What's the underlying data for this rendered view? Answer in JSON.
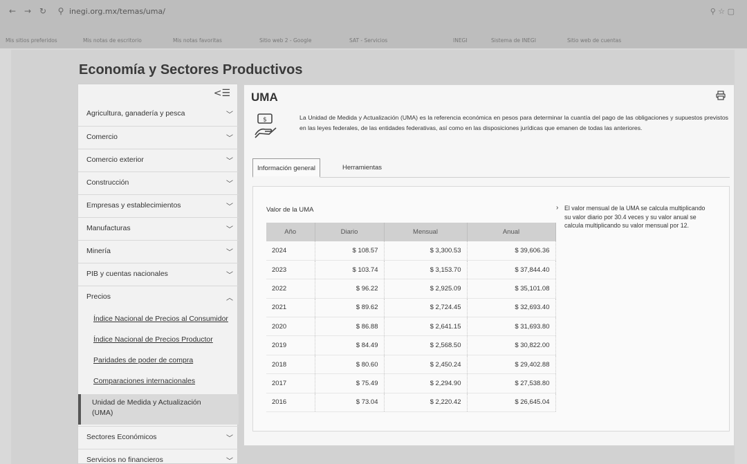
{
  "browser": {
    "url": "inegi.org.mx/temas/uma/",
    "bookmarks": [
      "Mis sitios preferidos",
      "Mis notas de escritorio",
      "Mis notas favoritas",
      "Sitio web 2 - Google",
      "SAT - Servicios",
      "INEGI",
      "Sistema de INEGI",
      "Sitio web de cuentas"
    ]
  },
  "page": {
    "heading": "Economía y Sectores Productivos"
  },
  "sidebar": {
    "collapse_icon": "collapse-left-icon",
    "items": [
      {
        "label": "Agricultura, ganadería y pesca",
        "chevron": "down"
      },
      {
        "label": "Comercio",
        "chevron": "down"
      },
      {
        "label": "Comercio exterior",
        "chevron": "down"
      },
      {
        "label": "Construcción",
        "chevron": "down"
      },
      {
        "label": "Empresas y establecimientos",
        "chevron": "down"
      },
      {
        "label": "Manufacturas",
        "chevron": "down"
      },
      {
        "label": "Minería",
        "chevron": "down"
      },
      {
        "label": "PIB y cuentas nacionales",
        "chevron": "down"
      },
      {
        "label": "Precios",
        "chevron": "up"
      }
    ],
    "sub_items": [
      "Índice Nacional de Precios al Consumidor",
      "Índice Nacional de Precios Productor",
      "Paridades de poder de compra",
      "Comparaciones internacionales"
    ],
    "active_item": "Unidad de Medida y Actualización (UMA)",
    "trailing_items": [
      {
        "label": "Sectores Económicos",
        "chevron": "down"
      },
      {
        "label": "Servicios no financieros",
        "chevron": "down"
      }
    ]
  },
  "main": {
    "title": "UMA",
    "intro": "La Unidad de Medida y Actualización (UMA) es la referencia económica en pesos para determinar la cuantía del pago de las obligaciones y supuestos previstos en las leyes federales, de las entidades federativas, así como en las disposiciones jurídicas que emanen de todas las anteriores.",
    "tabs": [
      "Información general",
      "Herramientas"
    ],
    "table_title": "Valor de la UMA",
    "table_headers": [
      "Año",
      "Diario",
      "Mensual",
      "Anual"
    ],
    "rows": [
      [
        "2024",
        "$ 108.57",
        "$ 3,300.53",
        "$ 39,606.36"
      ],
      [
        "2023",
        "$ 103.74",
        "$ 3,153.70",
        "$ 37,844.40"
      ],
      [
        "2022",
        "$ 96.22",
        "$ 2,925.09",
        "$ 35,101.08"
      ],
      [
        "2021",
        "$ 89.62",
        "$ 2,724.45",
        "$ 32,693.40"
      ],
      [
        "2020",
        "$ 86.88",
        "$ 2,641.15",
        "$ 31,693.80"
      ],
      [
        "2019",
        "$ 84.49",
        "$ 2,568.50",
        "$ 30,822.00"
      ],
      [
        "2018",
        "$ 80.60",
        "$ 2,450.24",
        "$ 29,402.88"
      ],
      [
        "2017",
        "$ 75.49",
        "$ 2,294.90",
        "$ 27,538.80"
      ],
      [
        "2016",
        "$ 73.04",
        "$ 2,220.42",
        "$ 26,645.04"
      ]
    ],
    "note": "El valor mensual de la UMA se calcula multiplicando su valor diario por 30.4 veces y su valor anual se calcula multiplicando su valor mensual por 12."
  }
}
